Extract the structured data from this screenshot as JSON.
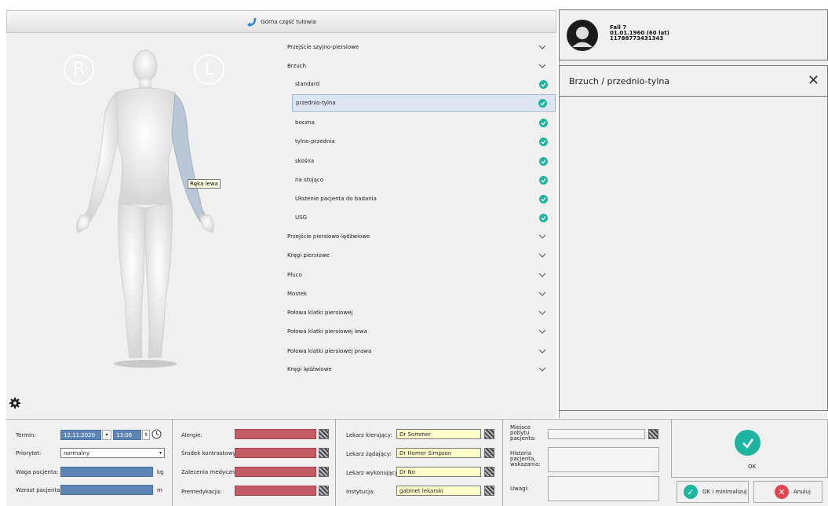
{
  "header": {
    "top_button_label": "Górna część tułowia"
  },
  "body_map": {
    "right_marker": "R",
    "left_marker": "L",
    "tooltip": "Ręka lewa"
  },
  "tree": {
    "items": [
      {
        "label": "Przejście szyjno-piersiowe",
        "type": "group"
      },
      {
        "label": "Brzuch",
        "type": "group",
        "expanded": true
      },
      {
        "label": "standard",
        "type": "child"
      },
      {
        "label": "przednio-tylna",
        "type": "child",
        "selected": true
      },
      {
        "label": "boczna",
        "type": "child"
      },
      {
        "label": "tylno-przednia",
        "type": "child"
      },
      {
        "label": "skośna",
        "type": "child"
      },
      {
        "label": "na stojąco",
        "type": "child"
      },
      {
        "label": "Ułożenie pacjenta do badania",
        "type": "child"
      },
      {
        "label": "USG",
        "type": "child"
      },
      {
        "label": "Przejście piersiowo-lędźwiowe",
        "type": "group"
      },
      {
        "label": "Kręgi piersiowe",
        "type": "group"
      },
      {
        "label": "Płuco",
        "type": "group"
      },
      {
        "label": "Mostek",
        "type": "group"
      },
      {
        "label": "Połowa klatki piersiowej",
        "type": "group"
      },
      {
        "label": "Połowa klatki piersiowej lewa",
        "type": "group"
      },
      {
        "label": "Połowa klatki piersiowej prawa",
        "type": "group"
      },
      {
        "label": "Kręgi lędźwiowe",
        "type": "group"
      }
    ]
  },
  "patient": {
    "name": "Fall 7",
    "dob": "01.01.1960 (60 lat)",
    "id": "11788773431343"
  },
  "detail": {
    "title": "Brzuch / przednio-tylna",
    "close_glyph": "✕"
  },
  "form": {
    "termin_label": "Termin:",
    "termin_date": "12.11.2020",
    "termin_time": "13:06",
    "priorytet_label": "Priorytet:",
    "priorytet_value": "normalny",
    "waga_label": "Waga pacjenta:",
    "waga_unit": "kg",
    "wzrost_label": "Wzrost pacjenta:",
    "wzrost_unit": "m",
    "alergie_label": "Alergie:",
    "srodek_label": "Środek kontrastowy:",
    "zalecenia_label": "Zalecenia medyczne:",
    "premedykacja_label": "Premedykacja:",
    "kierujacy_label": "Lekarz kierujący:",
    "kierujacy_value": "Dr Sommer",
    "zadajacy_label": "Lekarz żądający:",
    "zadajacy_value": "Dr Homer Simpson",
    "wykonujacy_label": "Lekarz wykonujący:",
    "wykonujacy_value": "Dr No",
    "instytucja_label": "Instytucja:",
    "instytucja_value": "gabinet lekarski",
    "miejsce_label": "Miejsce pobytu pacjenta:",
    "historia_label": "Historia pacjenta, wskazania:",
    "uwagi_label": "Uwagi:"
  },
  "actions": {
    "ok_label": "OK",
    "ok_min_label": "OK i minimalizuj",
    "cancel_label": "Anuluj"
  },
  "colors": {
    "accent_teal": "#1db5a0",
    "field_blue": "#5d86b6",
    "field_red": "#c45a63",
    "cancel_red": "#e0454f"
  }
}
